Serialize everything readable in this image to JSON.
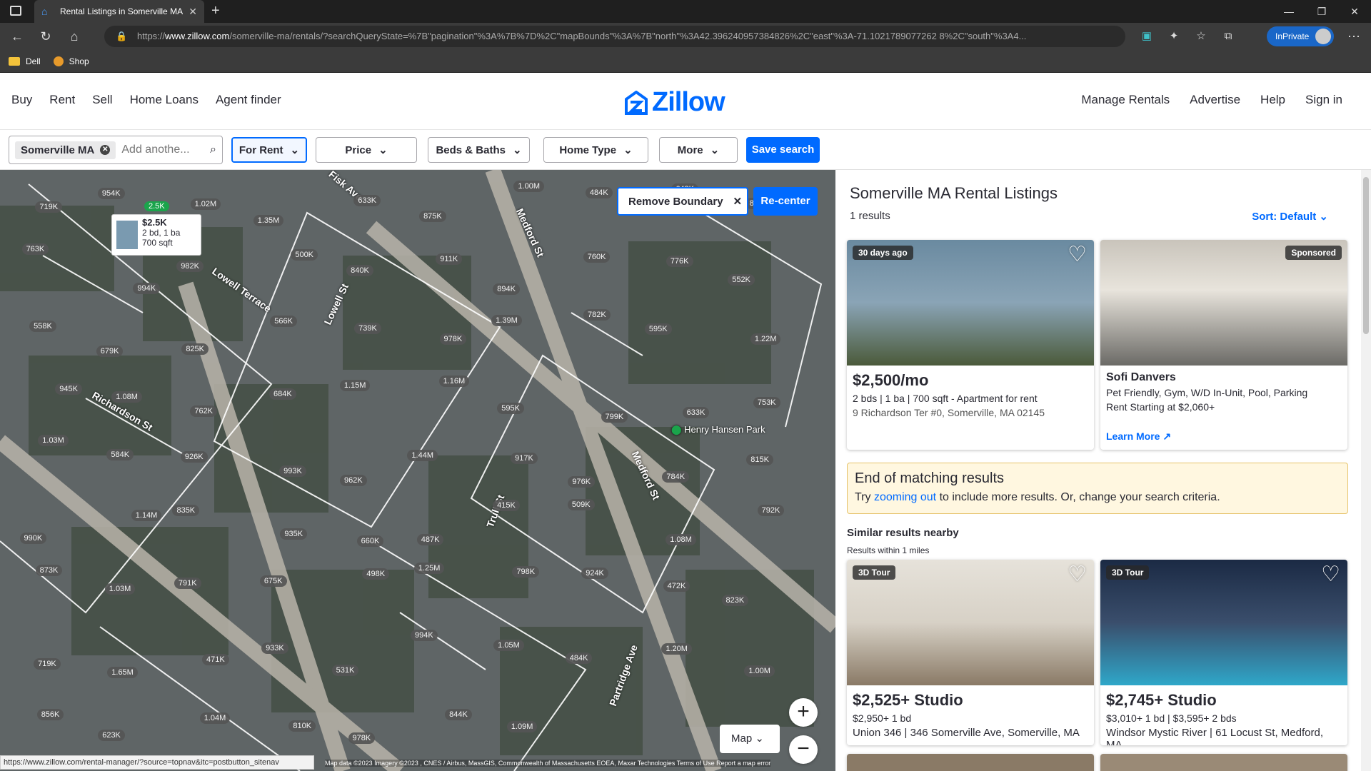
{
  "browser": {
    "tab_title": "Rental Listings in Somerville MA",
    "url_prefix": "https://",
    "url_domain": "www.zillow.com",
    "url_path": "/somerville-ma/rentals/?searchQueryState=%7B\"pagination\"%3A%7B%7D%2C\"mapBounds\"%3A%7B\"north\"%3A42.396240957384826%2C\"east\"%3A-71.1021789077262 8%2C\"south\"%3A4...",
    "inprivate_label": "InPrivate",
    "bookmarks": [
      "Dell",
      "Shop"
    ]
  },
  "nav": {
    "left": [
      "Buy",
      "Rent",
      "Sell",
      "Home Loans",
      "Agent finder"
    ],
    "logo": "Zillow",
    "right": [
      "Manage Rentals",
      "Advertise",
      "Help",
      "Sign in"
    ]
  },
  "filters": {
    "chip": "Somerville MA",
    "search_placeholder": "Add anothe...",
    "for_rent": "For Rent",
    "price": "Price",
    "beds_baths": "Beds & Baths",
    "home_type": "Home Type",
    "more": "More",
    "save_search": "Save search"
  },
  "map": {
    "remove_boundary": "Remove Boundary",
    "recenter": "Re-center",
    "map_type": "Map",
    "green_pin": "2.5K",
    "popup": {
      "price": "$2.5K",
      "beds": "2 bd, 1 ba",
      "sqft": "700 sqft"
    },
    "park": "Henry Hansen Park",
    "streets": [
      "Fisk Ave",
      "Medford St",
      "Lowell Terrace",
      "Lowell St",
      "Richardson St",
      "Trull St",
      "Partridge Ave",
      "Medford St"
    ],
    "pins": [
      "719K",
      "954K",
      "1.02M",
      "1.35M",
      "633K",
      "875K",
      "1.00M",
      "484K",
      "648K",
      "839K",
      "763K",
      "994K",
      "982K",
      "500K",
      "840K",
      "911K",
      "894K",
      "760K",
      "776K",
      "552K",
      "558K",
      "679K",
      "825K",
      "566K",
      "739K",
      "978K",
      "1.39M",
      "782K",
      "595K",
      "1.22M",
      "945K",
      "1.08M",
      "762K",
      "684K",
      "1.15M",
      "1.16M",
      "595K",
      "799K",
      "633K",
      "753K",
      "1.03M",
      "584K",
      "926K",
      "993K",
      "962K",
      "1.44M",
      "917K",
      "976K",
      "784K",
      "815K",
      "990K",
      "1.14M",
      "835K",
      "935K",
      "660K",
      "487K",
      "415K",
      "509K",
      "1.08M",
      "792K",
      "873K",
      "1.03M",
      "791K",
      "675K",
      "498K",
      "1.25M",
      "798K",
      "924K",
      "472K",
      "823K",
      "719K",
      "1.65M",
      "471K",
      "933K",
      "531K",
      "994K",
      "1.05M",
      "484K",
      "1.20M",
      "1.00M",
      "856K",
      "623K",
      "1.04M",
      "810K",
      "978K",
      "844K",
      "1.09M"
    ],
    "status_url": "https://www.zillow.com/rental-manager/?source=topnav&itc=postbutton_sitenav",
    "attribution": "Map data ©2023 Imagery ©2023 , CNES / Airbus, MassGIS, Commonwealth of Massachusetts EOEA, Maxar Technologies  Terms of Use  Report a map error"
  },
  "list": {
    "title": "Somerville MA Rental Listings",
    "count": "1 results",
    "sort": "Sort: Default",
    "card1": {
      "badge": "30 days ago",
      "price": "$2,500/mo",
      "details": "2 bds | 1 ba | 700 sqft - Apartment for rent",
      "address": "9 Richardson Ter #0, Somerville, MA 02145"
    },
    "card2": {
      "badge": "Sponsored",
      "name": "Sofi Danvers",
      "features": "Pet Friendly, Gym, W/D In-Unit, Pool, Parking",
      "rent": "Rent Starting at $2,060+",
      "link": "Learn More"
    },
    "end_title": "End of matching results",
    "end_pre": "Try ",
    "end_link": "zooming out",
    "end_post": " to include more results. Or, change your search criteria.",
    "similar": "Similar results nearby",
    "similar_sub": "Results within 1 miles",
    "card3": {
      "badge": "3D Tour",
      "price": "$2,525+ Studio",
      "line": "$2,950+ 1 bd",
      "address": "Union 346 | 346 Somerville Ave, Somerville, MA"
    },
    "card4": {
      "badge": "3D Tour",
      "price": "$2,745+ Studio",
      "line": "$3,010+ 1 bd | $3,595+ 2 bds",
      "address": "Windsor Mystic River | 61 Locust St, Medford, MA"
    }
  }
}
